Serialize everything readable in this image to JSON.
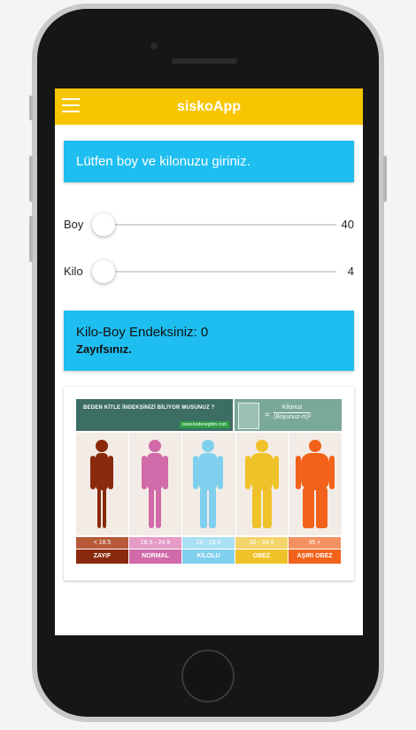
{
  "app": {
    "title": "siskoApp",
    "menu_icon": "hamburger-menu-icon"
  },
  "prompt": "Lütfen boy ve kilonuzu giriniz.",
  "sliders": [
    {
      "label": "Boy",
      "value": "40",
      "level": 0
    },
    {
      "label": "Kilo",
      "value": "4",
      "level": 0
    }
  ],
  "result": {
    "line1": "Kilo-Boy Endeksiniz: 0",
    "line2": "Zayıfsınız."
  },
  "infographic": {
    "heading": "BEDEN KİTLE İNDEKSİNİZİ BİLİYOR MUSUNUZ ?",
    "url": "www.bedenegitim.com",
    "formula_numerator": "Kilonuz",
    "formula_denominator": "(Boyunuz-m)²",
    "categories": [
      {
        "range": "< 18.5",
        "label": "ZAYIF",
        "color": "#8a2a0c",
        "bar": "#b85a3a"
      },
      {
        "range": "18.5 - 24.9",
        "label": "NORMAL",
        "color": "#d06aa8",
        "bar": "#e49bc6"
      },
      {
        "range": "25 - 29.9",
        "label": "KİLOLU",
        "color": "#7fd0ee",
        "bar": "#a9e0f3"
      },
      {
        "range": "30 - 34.9",
        "label": "OBEZ",
        "color": "#efc22a",
        "bar": "#f3d46a"
      },
      {
        "range": "35 <",
        "label": "AŞIRI OBEZ",
        "color": "#f2621a",
        "bar": "#f39162"
      }
    ]
  }
}
